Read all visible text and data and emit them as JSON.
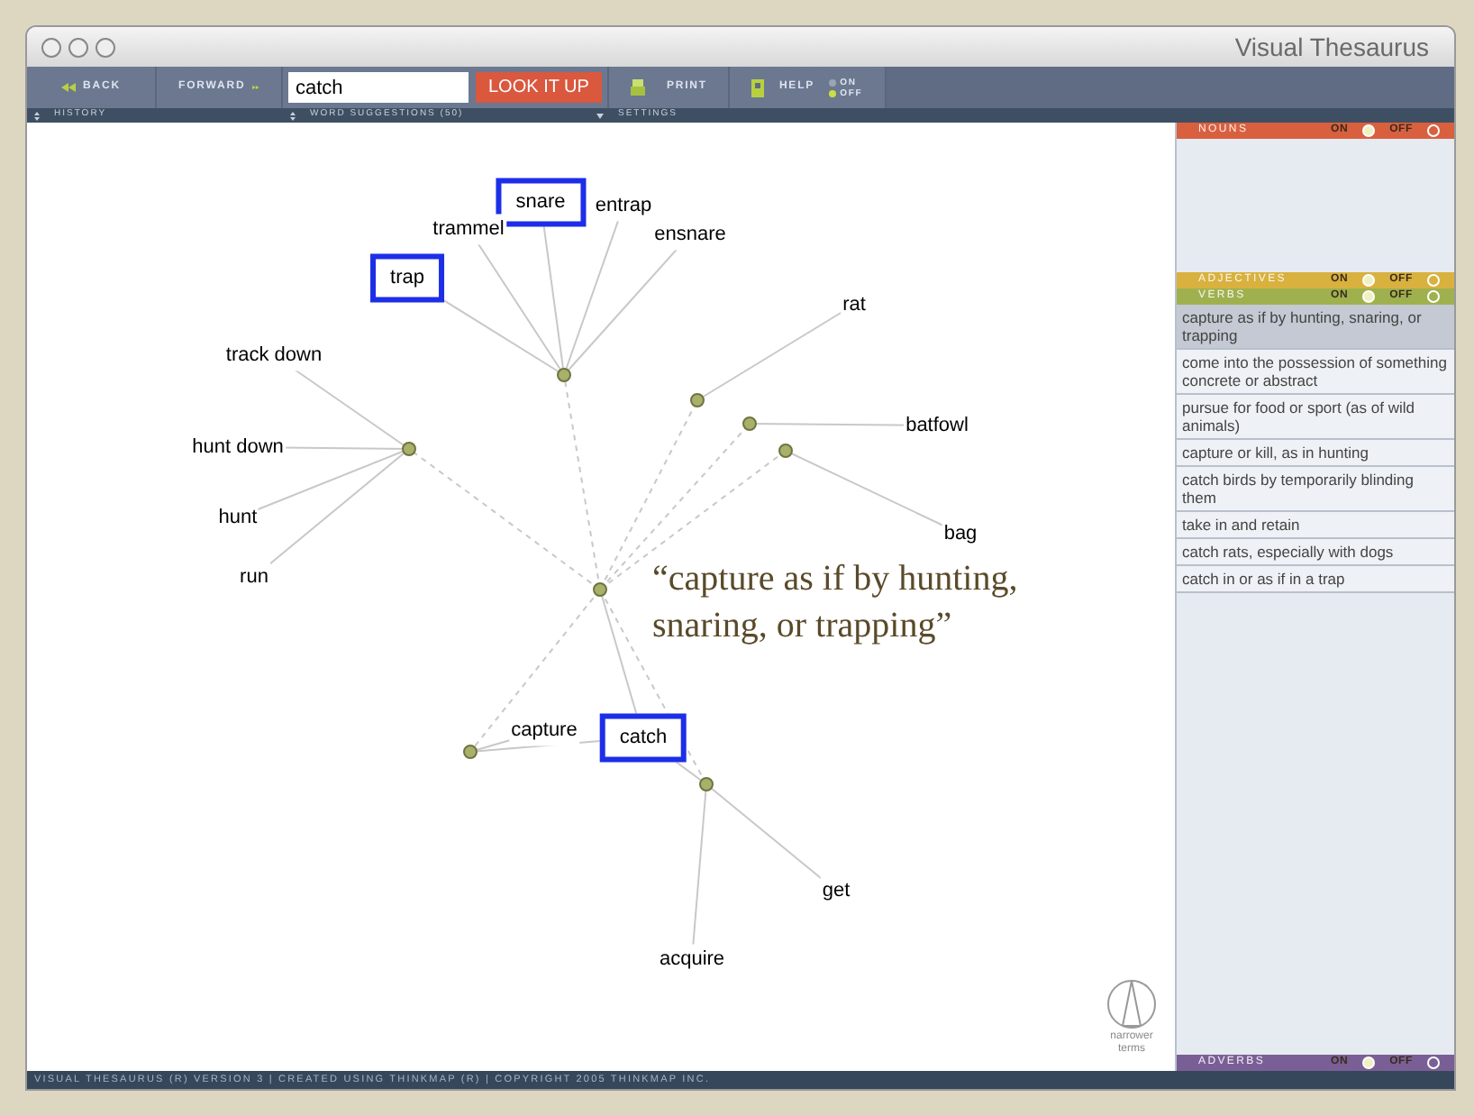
{
  "window": {
    "title": "Visual Thesaurus"
  },
  "toolbar": {
    "back": "BACK",
    "forward": "FORWARD",
    "search": {
      "value": "catch"
    },
    "lookup": "LOOK IT UP",
    "print": "PRINT",
    "help": "HELP",
    "help_on_label": "ON",
    "help_off_label": "OFF",
    "help_on": false
  },
  "subbar": [
    "HISTORY",
    "WORD SUGGESTIONS (50)",
    "SETTINGS"
  ],
  "words": [
    {
      "text": "snare",
      "highlighted": true
    },
    {
      "text": "entrap",
      "highlighted": false
    },
    {
      "text": "trammel",
      "highlighted": false
    },
    {
      "text": "ensnare",
      "highlighted": false
    },
    {
      "text": "trap",
      "highlighted": true
    },
    {
      "text": "rat",
      "highlighted": false
    },
    {
      "text": "track down",
      "highlighted": false
    },
    {
      "text": "hunt down",
      "highlighted": false
    },
    {
      "text": "batfowl",
      "highlighted": false
    },
    {
      "text": "hunt",
      "highlighted": false
    },
    {
      "text": "bag",
      "highlighted": false
    },
    {
      "text": "run",
      "highlighted": false
    },
    {
      "text": "capture",
      "highlighted": false
    },
    {
      "text": "catch",
      "highlighted": true
    },
    {
      "text": "get",
      "highlighted": false
    },
    {
      "text": "acquire",
      "highlighted": false
    }
  ],
  "definition": "“capture as if by hunting, snaring, or trapping”",
  "narrower": "narrower terms",
  "panels": [
    {
      "name": "NOUNS",
      "on": true,
      "color": "#d9603f",
      "on_label": "ON",
      "off_label": "OFF"
    },
    {
      "name": "ADJECTIVES",
      "on": true,
      "color": "#d8b13e",
      "on_label": "ON",
      "off_label": "OFF"
    },
    {
      "name": "VERBS",
      "on": true,
      "color": "#9fb14f",
      "on_label": "ON",
      "off_label": "OFF"
    },
    {
      "name": "ADVERBS",
      "on": true,
      "color": "#7a5f96",
      "on_label": "ON",
      "off_label": "OFF"
    }
  ],
  "senses": [
    {
      "text": "capture as if by hunting, snaring, or trapping",
      "selected": true
    },
    {
      "text": "come into the possession of something concrete or abstract",
      "selected": false
    },
    {
      "text": "pursue for food or sport (as of wild animals)",
      "selected": false
    },
    {
      "text": "capture or kill, as in hunting",
      "selected": false
    },
    {
      "text": "catch birds by temporarily blinding them",
      "selected": false
    },
    {
      "text": "take in and retain",
      "selected": false
    },
    {
      "text": "catch rats, especially with dogs",
      "selected": false
    },
    {
      "text": "catch in or as if in a trap",
      "selected": false
    }
  ],
  "status_bar": "VISUAL THESAURUS (R) VERSION 3 | CREATED USING THINKMAP (R) | COPYRIGHT 2005 THINKMAP INC."
}
